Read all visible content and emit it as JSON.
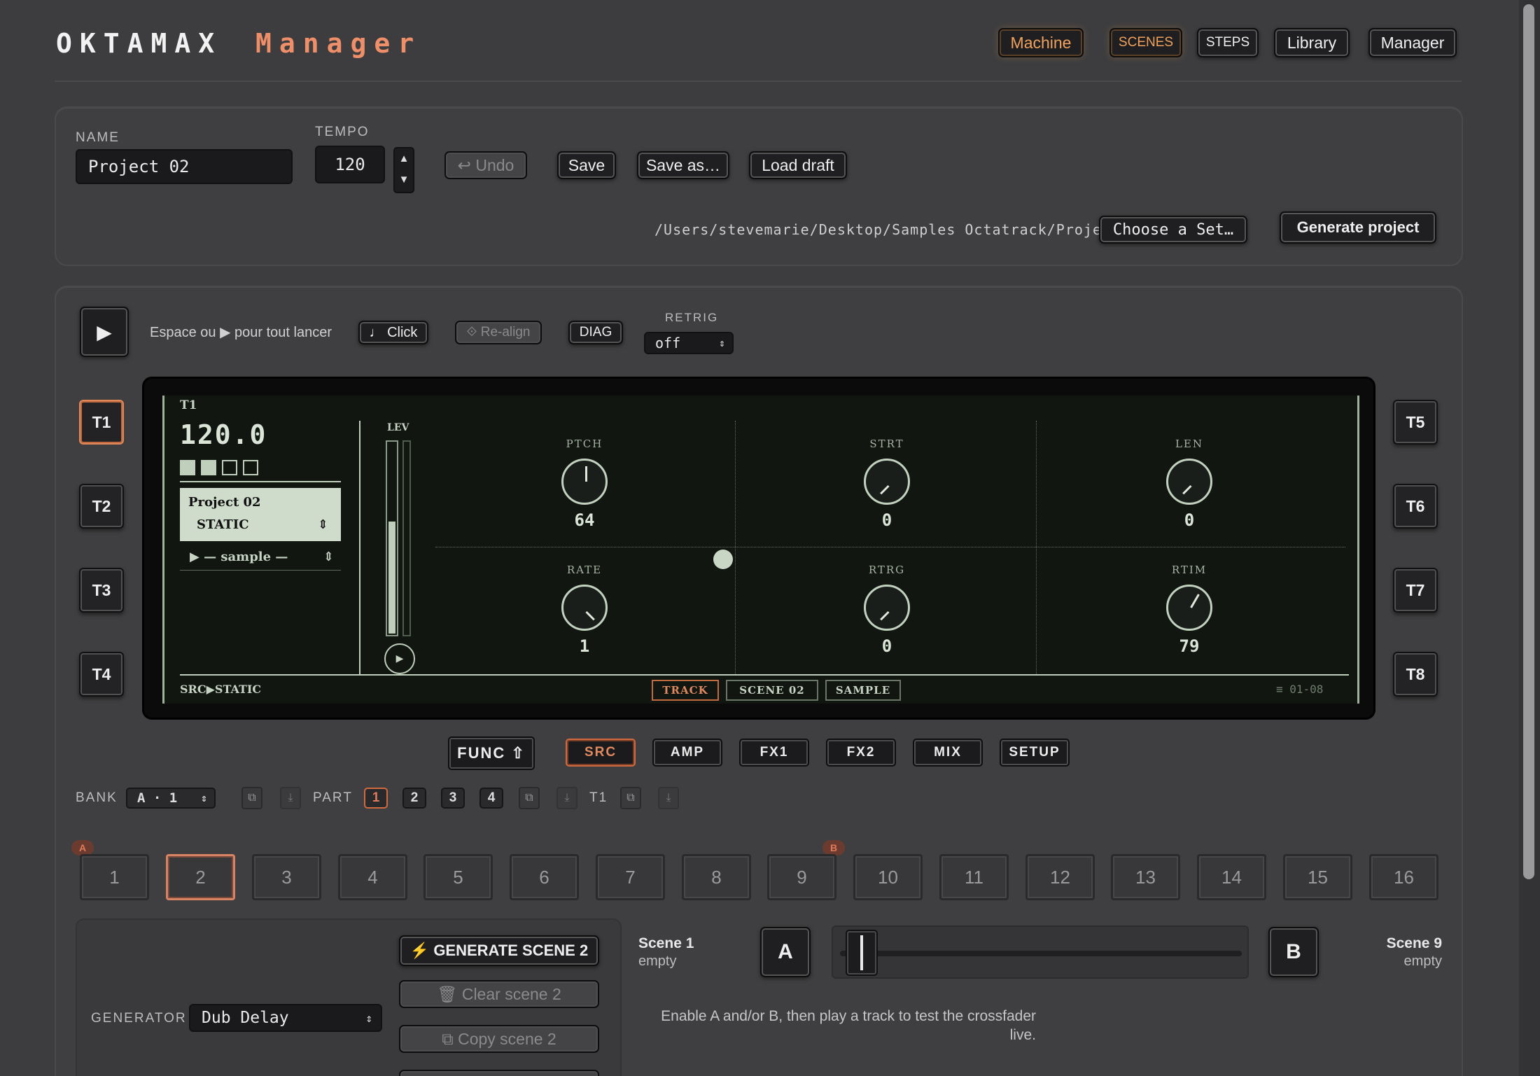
{
  "header": {
    "brand": "OKTAMAX",
    "brand_accent": "Manager",
    "nav": [
      {
        "label": "Machine",
        "active": true
      },
      {
        "label": "SCENES",
        "active": true
      },
      {
        "label": "STEPS"
      },
      {
        "label": "Library"
      },
      {
        "label": "Manager"
      }
    ]
  },
  "project": {
    "name_label": "NAME",
    "name_value": "Project 02",
    "tempo_label": "TEMPO",
    "tempo_value": "120",
    "undo": "↩ Undo",
    "save": "Save",
    "save_as": "Save as…",
    "load_draft": "Load draft",
    "path": "/Users/stevemarie/Desktop/Samples Octatrack/Project",
    "choose_set": "Choose a Set…",
    "generate_project": "Generate project"
  },
  "transport": {
    "hint": "Espace ou ▶ pour tout lancer",
    "click": "♩ Click",
    "realign": "⟐ Re-align",
    "diag": "DIAG",
    "retrig_label": "RETRIG",
    "retrig_value": "off"
  },
  "tracks_left": [
    "T1",
    "T2",
    "T3",
    "T4"
  ],
  "tracks_right": [
    "T5",
    "T6",
    "T7",
    "T8"
  ],
  "lcd": {
    "track": "T1",
    "bpm": "120.0",
    "project": "Project 02",
    "mode": "STATIC",
    "sample": "▶ — sample —",
    "lev_label": "LEV",
    "knobs": [
      {
        "label": "PTCH",
        "value": "64"
      },
      {
        "label": "STRT",
        "value": "0"
      },
      {
        "label": "LEN",
        "value": "0"
      },
      {
        "label": "RATE",
        "value": "1"
      },
      {
        "label": "RTRG",
        "value": "0"
      },
      {
        "label": "RTIM",
        "value": "79"
      }
    ],
    "footer_left": "SRC▶STATIC",
    "tabs": [
      "TRACK",
      "SCENE 02",
      "SAMPLE"
    ],
    "footer_right": "≡ 01-08"
  },
  "pages": {
    "func": "FUNC ⇧",
    "items": [
      "SRC",
      "AMP",
      "FX1",
      "FX2",
      "MIX",
      "SETUP"
    ]
  },
  "bank": {
    "label": "BANK",
    "value": "A · 1",
    "part_label": "PART",
    "parts": [
      "1",
      "2",
      "3",
      "4"
    ],
    "track_label": "T1"
  },
  "steps": {
    "items": [
      "1",
      "2",
      "3",
      "4",
      "5",
      "6",
      "7",
      "8",
      "9",
      "10",
      "11",
      "12",
      "13",
      "14",
      "15",
      "16"
    ],
    "marker_a": "A",
    "marker_b": "B"
  },
  "generator": {
    "generate": "⚡ GENERATE SCENE 2",
    "clear": "🗑 Clear scene 2",
    "copy": "⧉ Copy scene 2",
    "label": "GENERATOR",
    "value": "Dub Delay"
  },
  "crossfader": {
    "scene_a_title": "Scene 1",
    "scene_a_sub": "empty",
    "a": "A",
    "b": "B",
    "scene_b_title": "Scene 9",
    "scene_b_sub": "empty",
    "hint": "Enable A and/or B, then play a track to test the crossfader live.",
    "position": 0.0
  }
}
